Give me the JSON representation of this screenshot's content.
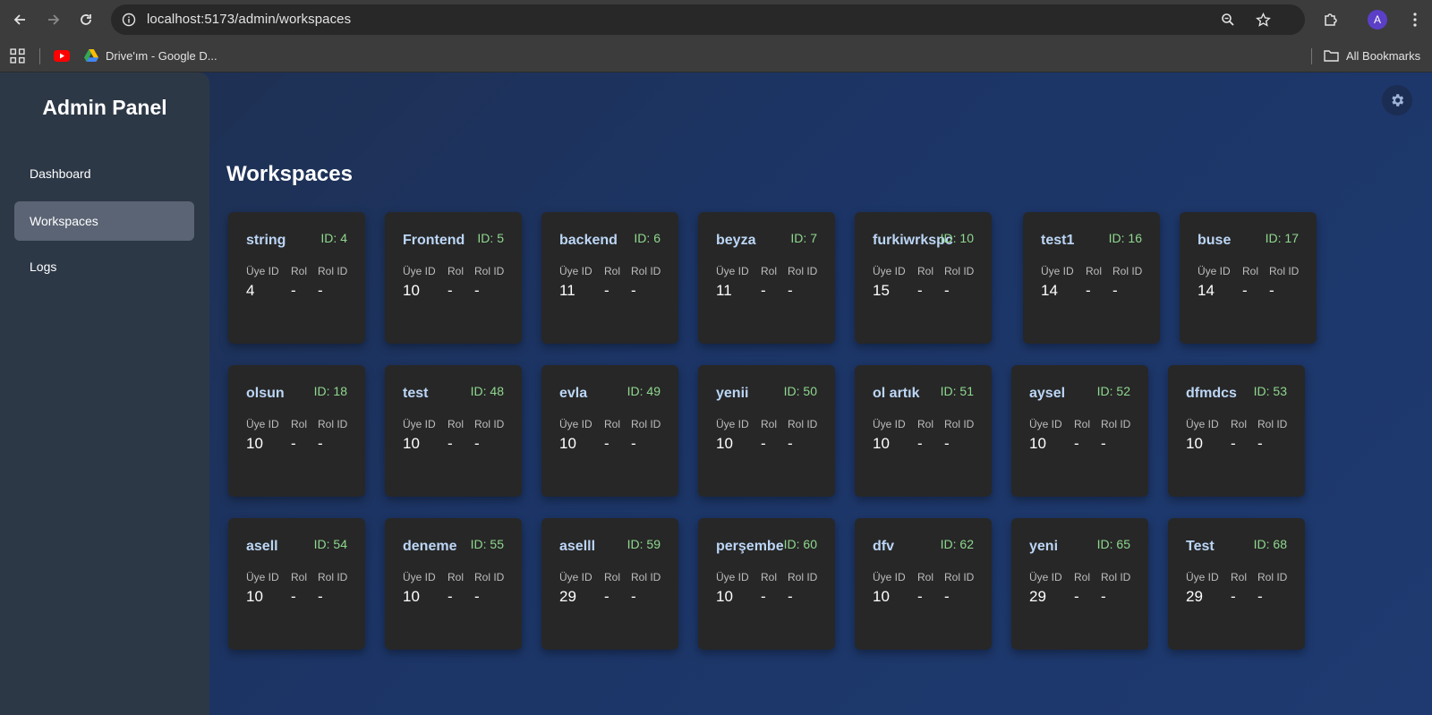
{
  "browser": {
    "url": "localhost:5173/admin/workspaces",
    "avatar_letter": "A",
    "bookmarks": [
      {
        "label": "Drive'ım - Google D..."
      }
    ],
    "all_bookmarks_label": "All Bookmarks"
  },
  "sidebar": {
    "title": "Admin Panel",
    "items": [
      {
        "label": "Dashboard",
        "active": false
      },
      {
        "label": "Workspaces",
        "active": true
      },
      {
        "label": "Logs",
        "active": false
      }
    ]
  },
  "main": {
    "heading": "Workspaces",
    "column_labels": {
      "member_id": "Üye ID",
      "role": "Rol",
      "role_id": "Rol ID"
    },
    "workspaces": [
      {
        "name": "string",
        "id": "ID: 4",
        "member_id": "4",
        "role": "-",
        "role_id": "-"
      },
      {
        "name": "Frontend",
        "id": "ID: 5",
        "member_id": "10",
        "role": "-",
        "role_id": "-"
      },
      {
        "name": "backend",
        "id": "ID: 6",
        "member_id": "11",
        "role": "-",
        "role_id": "-"
      },
      {
        "name": "beyza",
        "id": "ID: 7",
        "member_id": "11",
        "role": "-",
        "role_id": "-"
      },
      {
        "name": "furkiwrkspc",
        "id": "ID: 10",
        "member_id": "15",
        "role": "-",
        "role_id": "-"
      },
      {
        "name": "test1",
        "id": "ID: 16",
        "member_id": "14",
        "role": "-",
        "role_id": "-"
      },
      {
        "name": "buse",
        "id": "ID: 17",
        "member_id": "14",
        "role": "-",
        "role_id": "-"
      },
      {
        "name": "olsun",
        "id": "ID: 18",
        "member_id": "10",
        "role": "-",
        "role_id": "-"
      },
      {
        "name": "test",
        "id": "ID: 48",
        "member_id": "10",
        "role": "-",
        "role_id": "-"
      },
      {
        "name": "evla",
        "id": "ID: 49",
        "member_id": "10",
        "role": "-",
        "role_id": "-"
      },
      {
        "name": "yenii",
        "id": "ID: 50",
        "member_id": "10",
        "role": "-",
        "role_id": "-"
      },
      {
        "name": "ol artık",
        "id": "ID: 51",
        "member_id": "10",
        "role": "-",
        "role_id": "-"
      },
      {
        "name": "aysel",
        "id": "ID: 52",
        "member_id": "10",
        "role": "-",
        "role_id": "-"
      },
      {
        "name": "dfmdcs",
        "id": "ID: 53",
        "member_id": "10",
        "role": "-",
        "role_id": "-"
      },
      {
        "name": "asell",
        "id": "ID: 54",
        "member_id": "10",
        "role": "-",
        "role_id": "-"
      },
      {
        "name": "deneme",
        "id": "ID: 55",
        "member_id": "10",
        "role": "-",
        "role_id": "-"
      },
      {
        "name": "aselll",
        "id": "ID: 59",
        "member_id": "29",
        "role": "-",
        "role_id": "-"
      },
      {
        "name": "perşembe",
        "id": "ID: 60",
        "member_id": "10",
        "role": "-",
        "role_id": "-"
      },
      {
        "name": "dfv",
        "id": "ID: 62",
        "member_id": "10",
        "role": "-",
        "role_id": "-"
      },
      {
        "name": "yeni",
        "id": "ID: 65",
        "member_id": "29",
        "role": "-",
        "role_id": "-"
      },
      {
        "name": "Test",
        "id": "ID: 68",
        "member_id": "29",
        "role": "-",
        "role_id": "-"
      }
    ]
  },
  "colors": {
    "card_bg": "#272727",
    "name_color": "#bcd6f6",
    "id_color": "#8fd88f",
    "sidebar_bg": "#2d3847",
    "active_item_bg": "#5b6474"
  }
}
